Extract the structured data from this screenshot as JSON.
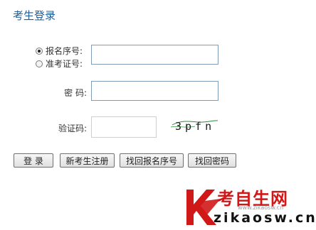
{
  "page": {
    "title": "考生登录"
  },
  "login_type": {
    "options": [
      {
        "label": "报名序号:",
        "selected": true
      },
      {
        "label": "准考证号:",
        "selected": false
      }
    ]
  },
  "form": {
    "id_value": "",
    "password_label": "密  码:",
    "password_value": "",
    "captcha_label": "验证码:",
    "captcha_value": "",
    "captcha_image_text": "3pfn"
  },
  "buttons": {
    "login": "登  录",
    "register": "新考生注册",
    "find_reg_number": "找回报名序号",
    "find_password": "找回密码"
  },
  "watermark": {
    "cn": "考自生网",
    "url": "www.zikaosw.cn",
    "en": "zikaosw.cn"
  },
  "colors": {
    "title": "#1f5c99",
    "input_border": "#7f9db9",
    "watermark_red": "#d01818"
  }
}
